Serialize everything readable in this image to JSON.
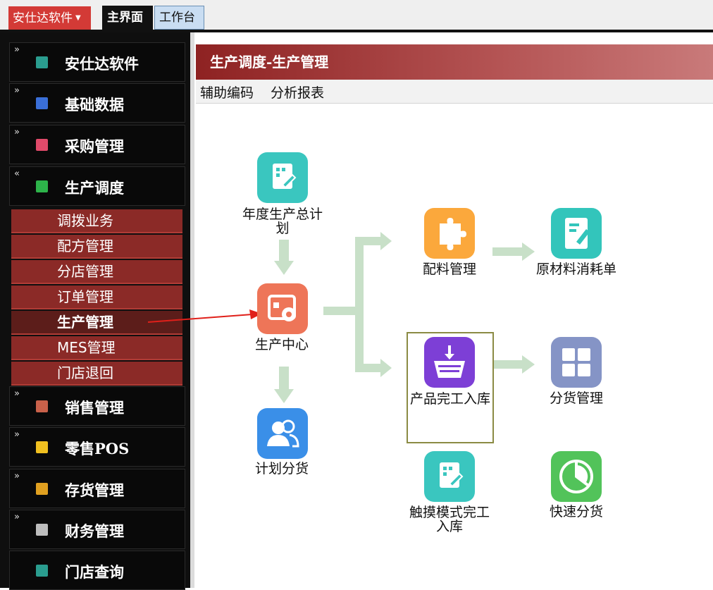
{
  "topbar": {
    "app_button": "安仕达软件",
    "tabs": [
      "主界面",
      "工作台"
    ]
  },
  "sidebar": {
    "items": [
      {
        "label": "安仕达软件",
        "chevron": "»",
        "color": "#2a9d8f"
      },
      {
        "label": "基础数据",
        "chevron": "»",
        "color": "#3a6fd8"
      },
      {
        "label": "采购管理",
        "chevron": "»",
        "color": "#e04a6a"
      },
      {
        "label": "生产调度",
        "chevron": "«",
        "color": "#2db34a"
      },
      {
        "label": "销售管理",
        "chevron": "»",
        "color": "#c9614a"
      },
      {
        "label": "零售POS",
        "chevron": "»",
        "color": "#f0c020"
      },
      {
        "label": "存货管理",
        "chevron": "»",
        "color": "#e0a020"
      },
      {
        "label": "财务管理",
        "chevron": "»",
        "color": "#bdbdbd"
      },
      {
        "label": "门店查询",
        "chevron": "",
        "color": "#2a9d8f"
      }
    ],
    "submenu": [
      "调拨业务",
      "配方管理",
      "分店管理",
      "订单管理",
      "生产管理",
      "MES管理",
      "门店退回"
    ],
    "active_submenu": "生产管理"
  },
  "content": {
    "title": "生产调度-生产管理",
    "menu": [
      "辅助编码",
      "分析报表"
    ]
  },
  "flow": {
    "annual_plan": "年度生产总计划",
    "production_center": "生产中心",
    "plan_distribution": "计划分货",
    "material_prep": "配料管理",
    "raw_consumption": "原材料消耗单",
    "finished_storage": "产品完工入库",
    "distribution_mgmt": "分货管理",
    "touch_storage": "触摸模式完工入库",
    "quick_distribution": "快速分货"
  },
  "colors": {
    "accent_red": "#8b2a27",
    "arrow_green": "#c8e0c8",
    "pointer_red": "#e0201a"
  }
}
